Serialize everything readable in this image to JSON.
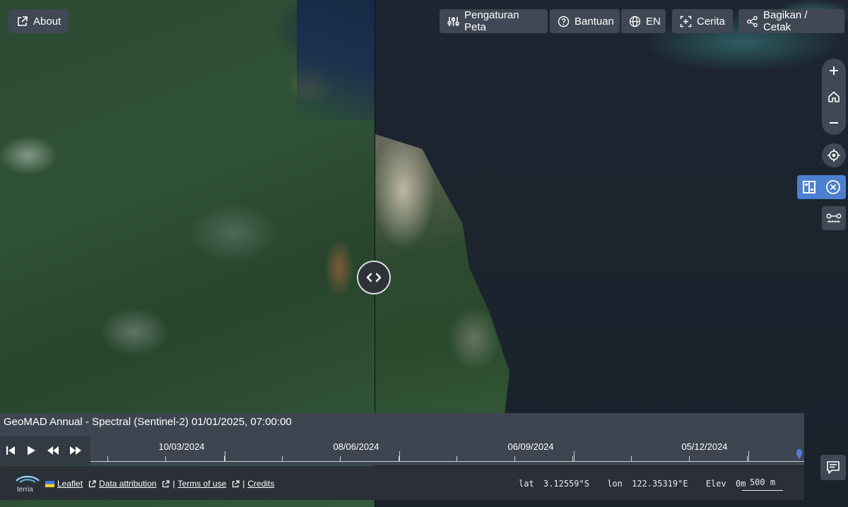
{
  "top_left": {
    "about_label": "About"
  },
  "toolbar": {
    "map_settings_label": "Pengaturan Peta",
    "help_label": "Bantuan",
    "language_label": "EN",
    "story_label": "Cerita",
    "share_label": "Bagikan / Cetak"
  },
  "timeline": {
    "title": "GeoMAD Annual - Spectral (Sentinel-2) 01/01/2025, 07:00:00",
    "date_labels": [
      "10/03/2024",
      "08/06/2024",
      "06/09/2024",
      "05/12/2024"
    ]
  },
  "footer": {
    "brand_name": "terria",
    "links": [
      "Leaflet",
      "Data attribution",
      "Terms of use",
      "Credits"
    ],
    "separator": "|",
    "lat_label": "lat",
    "lat_value": "3.12559°S",
    "lon_label": "lon",
    "lon_value": "122.35319°E",
    "elev_label": "Elev",
    "elev_value": "0m",
    "scale_label": "500 m"
  },
  "colors": {
    "button_bg": "#3f4854",
    "compare_active": "#4b7fd1",
    "timeline_bg": "#3e4551",
    "footer_bg": "#2b3038"
  }
}
